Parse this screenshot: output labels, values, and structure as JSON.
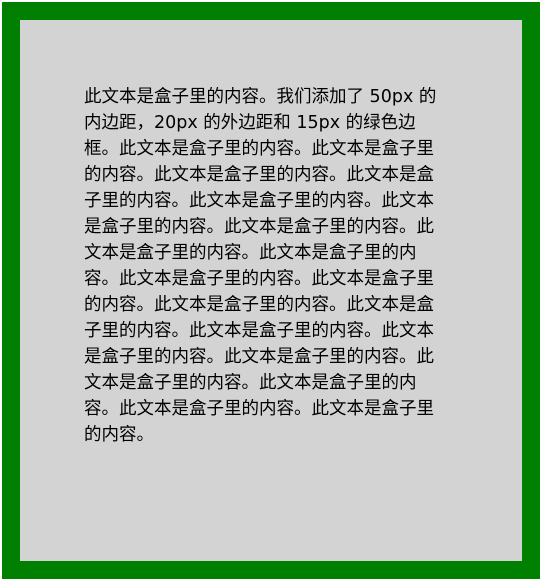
{
  "box": {
    "text": "此文本是盒子里的内容。我们添加了 50px 的内边距，20px 的外边距和 15px 的绿色边框。此文本是盒子里的内容。此文本是盒子里的内容。此文本是盒子里的内容。此文本是盒子里的内容。此文本是盒子里的内容。此文本是盒子里的内容。此文本是盒子里的内容。此文本是盒子里的内容。此文本是盒子里的内容。此文本是盒子里的内容。此文本是盒子里的内容。此文本是盒子里的内容。此文本是盒子里的内容。此文本是盒子里的内容。此文本是盒子里的内容。此文本是盒子里的内容。此文本是盒子里的内容。此文本是盒子里的内容。此文本是盒子里的内容。此文本是盒子里的内容。",
    "border_color": "#008000",
    "background_color": "#d3d3d3"
  }
}
